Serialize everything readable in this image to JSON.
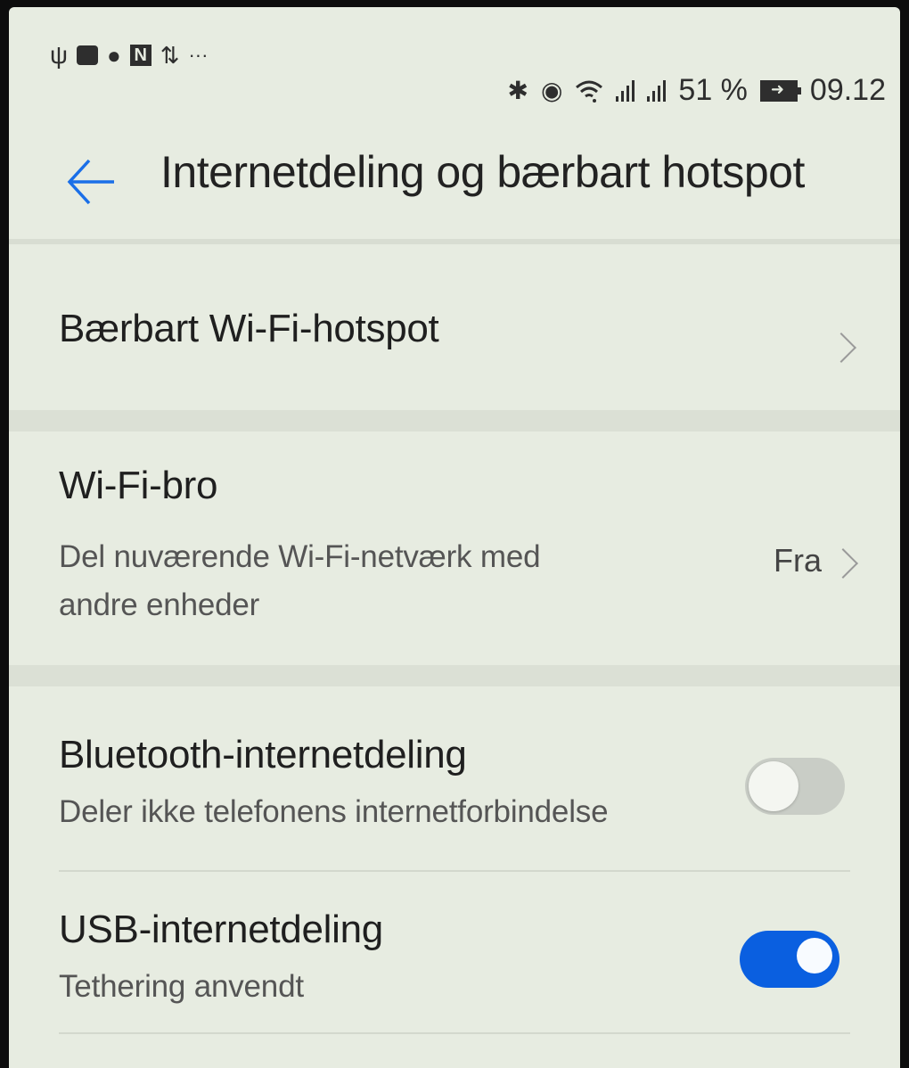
{
  "status_bar": {
    "left_icons": [
      "usb-icon",
      "youtube-icon",
      "facebook-icon",
      "n-app-icon",
      "data-transfer-icon",
      "more-icon"
    ],
    "right_icons": [
      "bluetooth-icon",
      "eye-comfort-icon",
      "wifi-hotspot-icon",
      "signal-icon",
      "signal-icon-2",
      "battery-charging-icon"
    ],
    "more_label": "···",
    "battery_percent": "51 %",
    "time": "09.12"
  },
  "header": {
    "back_icon": "back-arrow-icon",
    "title": "Internetdeling og bærbart hotspot"
  },
  "settings": {
    "portable_hotspot": {
      "title": "Bærbart Wi-Fi-hotspot"
    },
    "wifi_bridge": {
      "title": "Wi-Fi-bro",
      "subtitle_line1": "Del nuværende Wi-Fi-netværk med",
      "subtitle_line2": "andre enheder",
      "value": "Fra"
    },
    "bluetooth_tethering": {
      "title": "Bluetooth-internetdeling",
      "subtitle": "Deler ikke telefonens internetforbindelse",
      "enabled": false
    },
    "usb_tethering": {
      "title": "USB-internetdeling",
      "subtitle": "Tethering anvendt",
      "enabled": true
    }
  },
  "colors": {
    "accent": "#0a5fe0",
    "background": "#e7ece1",
    "toggle_off": "#c9cdc6"
  }
}
